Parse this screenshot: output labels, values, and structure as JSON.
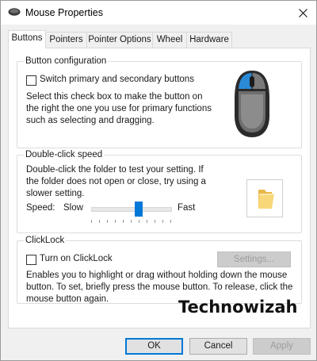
{
  "window": {
    "title": "Mouse Properties"
  },
  "icons": {
    "app": "mouse-app-icon",
    "close": "close-icon",
    "mouse_image": "mouse-illustration",
    "folder": "folder-icon"
  },
  "colors": {
    "accent": "#0078d7",
    "mouse_body": "#2b2b2b",
    "mouse_button": "#2a8ad6"
  },
  "tabs": [
    {
      "label": "Buttons",
      "active": true
    },
    {
      "label": "Pointers",
      "active": false
    },
    {
      "label": "Pointer Options",
      "active": false
    },
    {
      "label": "Wheel",
      "active": false
    },
    {
      "label": "Hardware",
      "active": false
    }
  ],
  "button_config": {
    "legend": "Button configuration",
    "checkbox_label": "Switch primary and secondary buttons",
    "checked": false,
    "description": "Select this check box to make the button on the right the one you use for primary functions such as selecting and dragging."
  },
  "double_click": {
    "legend": "Double-click speed",
    "description": "Double-click the folder to test your setting. If the folder does not open or close, try using a slower setting.",
    "speed_label": "Speed:",
    "slow_label": "Slow",
    "fast_label": "Fast",
    "slider_fraction": 0.6
  },
  "clicklock": {
    "legend": "ClickLock",
    "checkbox_label": "Turn on ClickLock",
    "checked": false,
    "settings_button": "Settings...",
    "description": "Enables you to highlight or drag without holding down the mouse button. To set, briefly press the mouse button. To release, click the mouse button again."
  },
  "watermark": "Technowizah",
  "footer": {
    "ok": "OK",
    "cancel": "Cancel",
    "apply": "Apply"
  }
}
